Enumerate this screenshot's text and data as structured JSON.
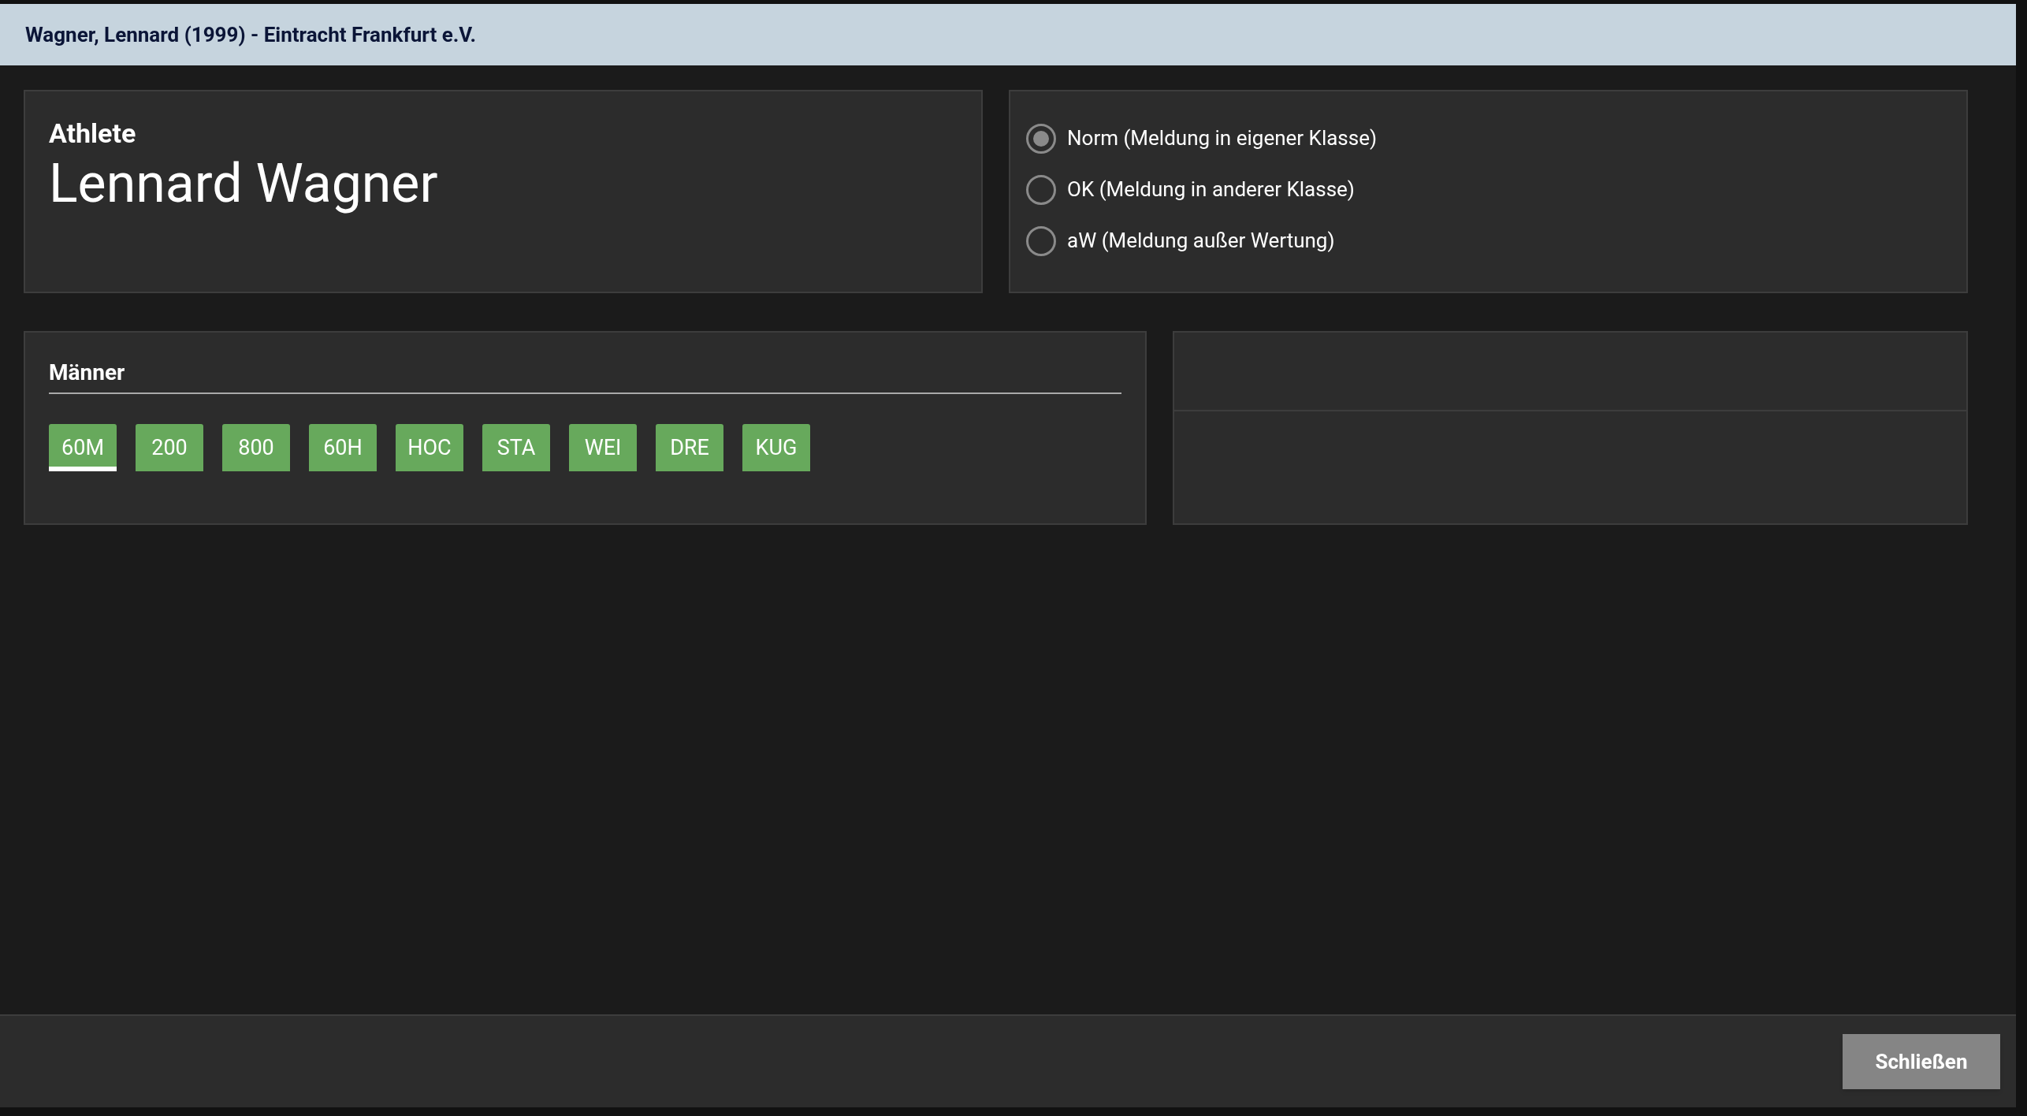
{
  "window": {
    "title": "Wagner, Lennard (1999) - Eintracht Frankfurt e.V."
  },
  "athlete": {
    "label": "Athlete",
    "name": "Lennard Wagner"
  },
  "entry_types": [
    {
      "label": "Norm (Meldung in eigener Klasse)",
      "selected": true
    },
    {
      "label": "OK (Meldung in anderer Klasse)",
      "selected": false
    },
    {
      "label": "aW (Meldung außer Wertung)",
      "selected": false
    }
  ],
  "events": {
    "group": "Männer",
    "tabs": [
      {
        "label": "60M",
        "selected": true
      },
      {
        "label": "200",
        "selected": false
      },
      {
        "label": "800",
        "selected": false
      },
      {
        "label": "60H",
        "selected": false
      },
      {
        "label": "HOC",
        "selected": false
      },
      {
        "label": "STA",
        "selected": false
      },
      {
        "label": "WEI",
        "selected": false
      },
      {
        "label": "DRE",
        "selected": false
      },
      {
        "label": "KUG",
        "selected": false
      }
    ]
  },
  "buttons": [
    {
      "label": "Schließen"
    }
  ]
}
